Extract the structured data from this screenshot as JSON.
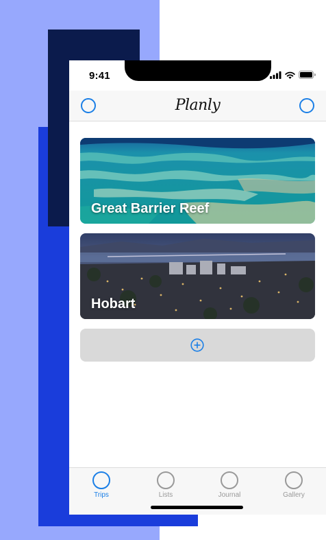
{
  "status_bar": {
    "time": "9:41"
  },
  "nav_bar": {
    "title": "Planly"
  },
  "trips": [
    {
      "title": "Great Barrier Reef"
    },
    {
      "title": "Hobart"
    }
  ],
  "tab_bar": {
    "tabs": [
      {
        "label": "Trips",
        "active": true
      },
      {
        "label": "Lists",
        "active": false
      },
      {
        "label": "Journal",
        "active": false
      },
      {
        "label": "Gallery",
        "active": false
      }
    ]
  },
  "colors": {
    "accent": "#1b7fe6",
    "inactive": "#999999",
    "background_lavender": "#97a8fd",
    "background_blue": "#1a3ddb",
    "background_navy": "#0b1b4c",
    "add_button_bg": "#d9d9d9"
  },
  "icons": {
    "nav_left": "circle-icon",
    "nav_right": "circle-icon",
    "add_trip": "plus-circle-icon"
  }
}
